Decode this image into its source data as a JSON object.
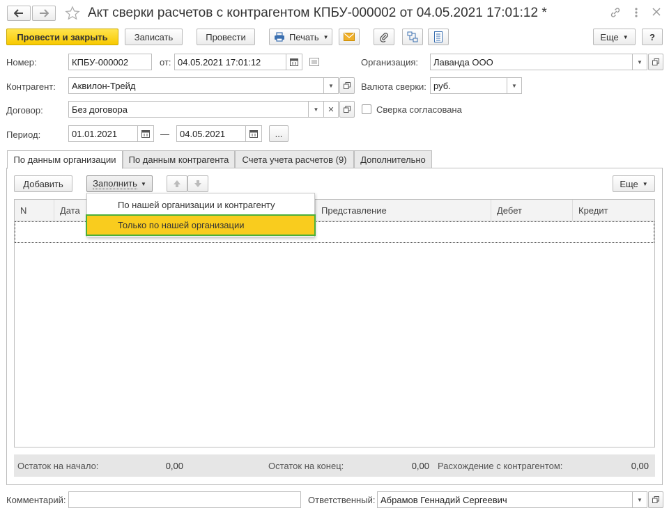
{
  "window": {
    "title": "Акт сверки расчетов с контрагентом КПБУ-000002 от 04.05.2021 17:01:12 *"
  },
  "toolbar": {
    "post_close": "Провести и закрыть",
    "save": "Записать",
    "post": "Провести",
    "print": "Печать",
    "more": "Еще",
    "help": "?"
  },
  "form": {
    "number_label": "Номер:",
    "number_value": "КПБУ-000002",
    "from_label": "от:",
    "date_value": "04.05.2021 17:01:12",
    "org_label": "Организация:",
    "org_value": "Лаванда ООО",
    "counterparty_label": "Контрагент:",
    "counterparty_value": "Аквилон-Трейд",
    "currency_label": "Валюта сверки:",
    "currency_value": "руб.",
    "contract_label": "Договор:",
    "contract_value": "Без договора",
    "agreed_label": "Сверка согласована",
    "period_label": "Период:",
    "period_start": "01.01.2021",
    "period_dash": "—",
    "period_end": "04.05.2021",
    "period_more": "..."
  },
  "tabs": [
    {
      "label": "По данным организации"
    },
    {
      "label": "По данным контрагента"
    },
    {
      "label": "Счета учета расчетов (9)"
    },
    {
      "label": "Дополнительно"
    }
  ],
  "table_toolbar": {
    "add": "Добавить",
    "fill": "Заполнить",
    "more": "Еще"
  },
  "table": {
    "columns": [
      "N",
      "Дата",
      "Представление",
      "Дебет",
      "Кредит"
    ]
  },
  "dropdown": {
    "items": [
      {
        "label": "По нашей организации и контрагенту"
      },
      {
        "label": "Только по нашей организации"
      }
    ]
  },
  "totals": {
    "start_label": "Остаток на начало:",
    "start_value": "0,00",
    "end_label": "Остаток на конец:",
    "end_value": "0,00",
    "diff_label": "Расхождение с контрагентом:",
    "diff_value": "0,00"
  },
  "footer": {
    "comment_label": "Комментарий:",
    "comment_value": "",
    "responsible_label": "Ответственный:",
    "responsible_value": "Абрамов Геннадий Сергеевич"
  },
  "colors": {
    "primary": "#f8c900",
    "highlight": "#f9cc1e",
    "focus_frame": "#4caf3a"
  }
}
